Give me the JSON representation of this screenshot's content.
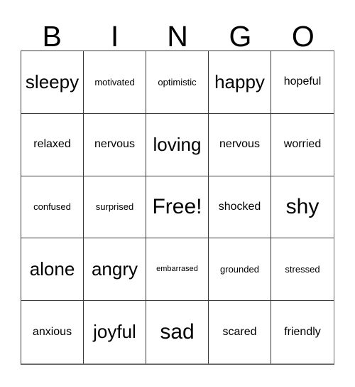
{
  "card": {
    "title": "BINGO",
    "header_letters": [
      "B",
      "I",
      "N",
      "G",
      "O"
    ],
    "free_space_label": "Free!",
    "rows": [
      [
        {
          "label": "sleepy",
          "size": "s-lg"
        },
        {
          "label": "motivated",
          "size": "s-xs"
        },
        {
          "label": "optimistic",
          "size": "s-xs"
        },
        {
          "label": "happy",
          "size": "s-lg"
        },
        {
          "label": "hopeful",
          "size": "s-sm"
        }
      ],
      [
        {
          "label": "relaxed",
          "size": "s-sm"
        },
        {
          "label": "nervous",
          "size": "s-sm"
        },
        {
          "label": "loving",
          "size": "s-lg"
        },
        {
          "label": "nervous",
          "size": "s-sm"
        },
        {
          "label": "worried",
          "size": "s-sm"
        }
      ],
      [
        {
          "label": "confused",
          "size": "s-xs"
        },
        {
          "label": "surprised",
          "size": "s-xs"
        },
        {
          "label": "Free!",
          "size": "s-xl"
        },
        {
          "label": "shocked",
          "size": "s-sm"
        },
        {
          "label": "shy",
          "size": "s-xl"
        }
      ],
      [
        {
          "label": "alone",
          "size": "s-lg"
        },
        {
          "label": "angry",
          "size": "s-lg"
        },
        {
          "label": "embarrased",
          "size": "s-xxs"
        },
        {
          "label": "grounded",
          "size": "s-xs"
        },
        {
          "label": "stressed",
          "size": "s-xs"
        }
      ],
      [
        {
          "label": "anxious",
          "size": "s-sm"
        },
        {
          "label": "joyful",
          "size": "s-lg"
        },
        {
          "label": "sad",
          "size": "s-xl"
        },
        {
          "label": "scared",
          "size": "s-sm"
        },
        {
          "label": "friendly",
          "size": "s-sm"
        }
      ]
    ]
  },
  "colors": {
    "background": "#ffffff",
    "text": "#000000",
    "grid_line": "#3a3a3a",
    "grid_outer": "#6b6b6b"
  }
}
